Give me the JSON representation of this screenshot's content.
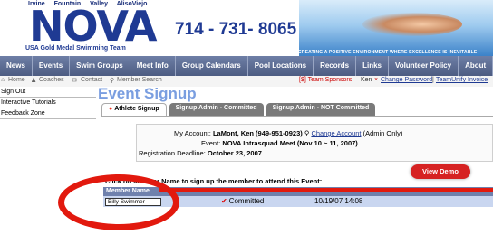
{
  "banner": {
    "cities": "Irvine   Fountain Valley   AlisoViejo",
    "logo": "NOVA",
    "subtitle": "USA Gold Medal Swimming Team",
    "phone": "714 - 731- 8065",
    "tagline": "CREATING A POSITIVE ENVIRONMENT WHERE EXCELLENCE IS INEVITABLE"
  },
  "nav": {
    "items": [
      "News",
      "Events",
      "Swim Groups",
      "Meet Info",
      "Group Calendars",
      "Pool Locations",
      "Records",
      "Links",
      "Volunteer Policy",
      "About"
    ]
  },
  "util": {
    "home": "Home",
    "coaches": "Coaches",
    "contact": "Contact",
    "member_search": "Member Search",
    "sponsors": "[$] Team Sponsors",
    "user": "Ken",
    "change_password": "Change Password",
    "teamunify": "TeamUnify Invoice"
  },
  "sidebar": {
    "items": [
      "Sign Out",
      "Interactive Tutorials",
      "Feedback Zone"
    ]
  },
  "main": {
    "title": "Event Signup",
    "tabs": [
      "Athlete Signup",
      "Signup Admin - Committed",
      "Signup Admin - NOT Committed"
    ],
    "account_label": "My Account:",
    "account_value": "LaMont, Ken (949-951-0923)",
    "change_account": "Change Account",
    "admin_only": "(Admin Only)",
    "event_label": "Event:",
    "event_value": "NOVA Intrasquad Meet (Nov 10 ~ 11, 2007)",
    "deadline_label": "Registration Deadline:",
    "deadline_value": "October 23, 2007",
    "instruction": "Click on Member Name to sign up the member to attend this Event:",
    "view_demo": "View Demo",
    "table_header": "Member Name",
    "row": {
      "member": "Billy Swimmer",
      "status": "Committed",
      "timestamp": "10/19/07 14:08"
    }
  },
  "colors": {
    "nav_bg": "#5a6a91",
    "title": "#7a9ee0",
    "annotation": "#e2190e",
    "demo_button": "#d62222"
  }
}
